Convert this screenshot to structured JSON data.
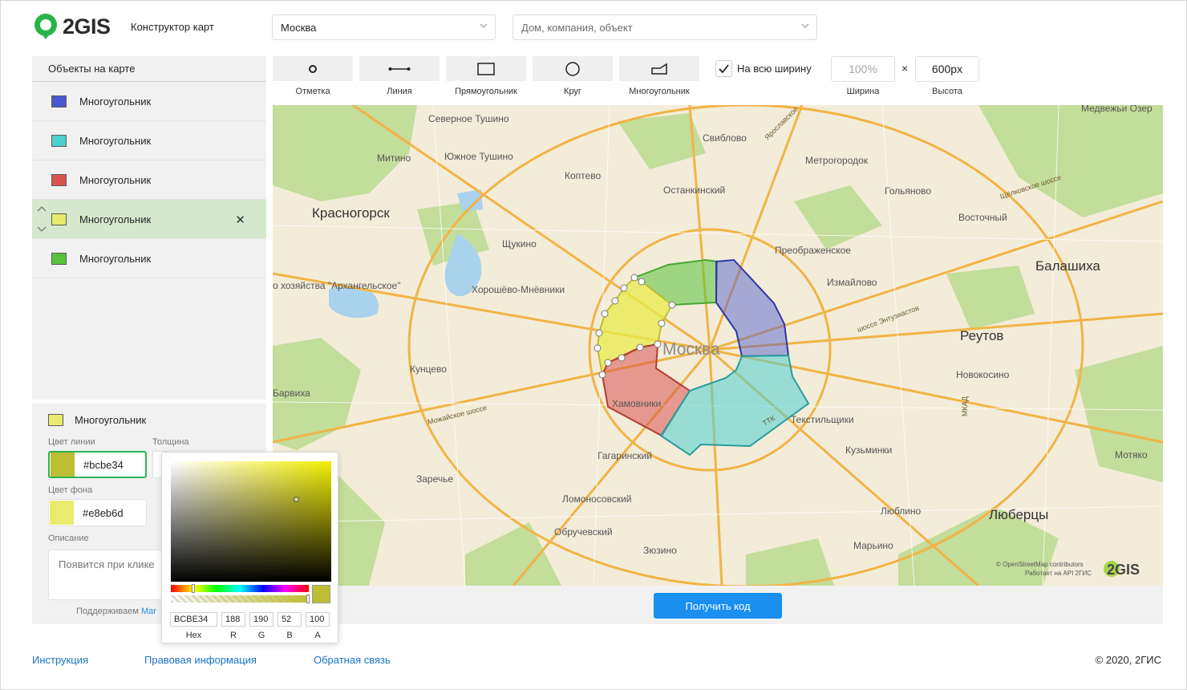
{
  "header": {
    "logo": "2GIS",
    "subtitle": "Конструктор карт",
    "city": "Москва",
    "search_placeholder": "Дом, компания, объект"
  },
  "sidebar": {
    "title": "Объекты на карте",
    "items": [
      {
        "label": "Многоугольник",
        "color": "#4a56cf"
      },
      {
        "label": "Многоугольник",
        "color": "#4ccfcf"
      },
      {
        "label": "Многоугольник",
        "color": "#d9534f"
      },
      {
        "label": "Многоугольник",
        "color": "#e8eb6d",
        "active": true
      },
      {
        "label": "Многоугольник",
        "color": "#56c23c"
      }
    ]
  },
  "props": {
    "title": "Многоугольник",
    "line_color_label": "Цвет линии",
    "line_color": "#bcbe34",
    "thickness_label": "Толщина",
    "fill_color_label": "Цвет фона",
    "fill_color": "#e8eb6d",
    "description_label": "Описание",
    "description_placeholder": "Появится при клике",
    "support_text": "Поддерживаем",
    "support_link": "Mar"
  },
  "picker": {
    "hex": "BCBE34",
    "r": "188",
    "g": "190",
    "b": "52",
    "a": "100",
    "labels": [
      "Hex",
      "R",
      "G",
      "B",
      "A"
    ]
  },
  "toolbar": {
    "tools": [
      {
        "label": "Отметка",
        "icon": "point-icon"
      },
      {
        "label": "Линия",
        "icon": "line-icon"
      },
      {
        "label": "Прямоугольник",
        "icon": "rectangle-icon"
      },
      {
        "label": "Круг",
        "icon": "circle-icon"
      },
      {
        "label": "Многоугольник",
        "icon": "polygon-icon"
      }
    ],
    "full_width_label": "На всю ширину",
    "width_value": "100%",
    "height_value": "600px",
    "times": "×",
    "width_label": "Ширина",
    "height_label": "Высота"
  },
  "map": {
    "labels": {
      "severnoe_tushino": "Северное Тушино",
      "yuzhnoe_tushino": "Южное Тушино",
      "mitino": "Митино",
      "koptevo": "Коптево",
      "sviblovo": "Свиблово",
      "medvezhi": "Медвежьи Озер",
      "metrogorodok": "Метрогородок",
      "ostankino": "Останкинский",
      "golyanovo": "Гольяново",
      "krasnogorsk": "Красногорск",
      "vostochny": "Восточный",
      "shchukino": "Щукино",
      "preobrazhenskoe": "Преображенское",
      "balashikha": "Балашиха",
      "arkhangelskoe": "о хозяйства \"Архангельское\"",
      "khoroshevo": "Хорошёво-Мнёвники",
      "izmaylovo": "Измайлово",
      "moskva": "Москва",
      "reutov": "Реутов",
      "kuntsevo": "Кунцево",
      "novokosino": "Новокосино",
      "barvikha": "Барвиха",
      "khamovniki": "Хамовники",
      "tekstilshchiki": "Текстильщики",
      "mozhayskoe": "Можайское шоссе",
      "entuziastov": "шоссе Энтузиастов",
      "shchelkovskoe": "Щёлковское шоссе",
      "yaroslavskoe": "Ярославское",
      "gagarinsky": "Гагаринский",
      "kuzminki": "Кузьминки",
      "zarechye": "Заречье",
      "motyako": "Мотяко",
      "lomonosovsky": "Ломоносовский",
      "lyublino": "Люблино",
      "lyubertsy": "Люберцы",
      "obruchevsky": "Обручевский",
      "marino": "Марьино",
      "zyuzino": "Зюзино",
      "ttk": "ТТК",
      "mkad": "МКАД"
    },
    "attribution": "© OpenStreetMap contributors",
    "attribution2": "Работает на API 2ГИС",
    "map_logo": "2GIS"
  },
  "get_code_label": "Получить код",
  "footer": {
    "instructions": "Инструкция",
    "legal": "Правовая информация",
    "feedback": "Обратная связь",
    "copyright": "© 2020, 2ГИС"
  }
}
